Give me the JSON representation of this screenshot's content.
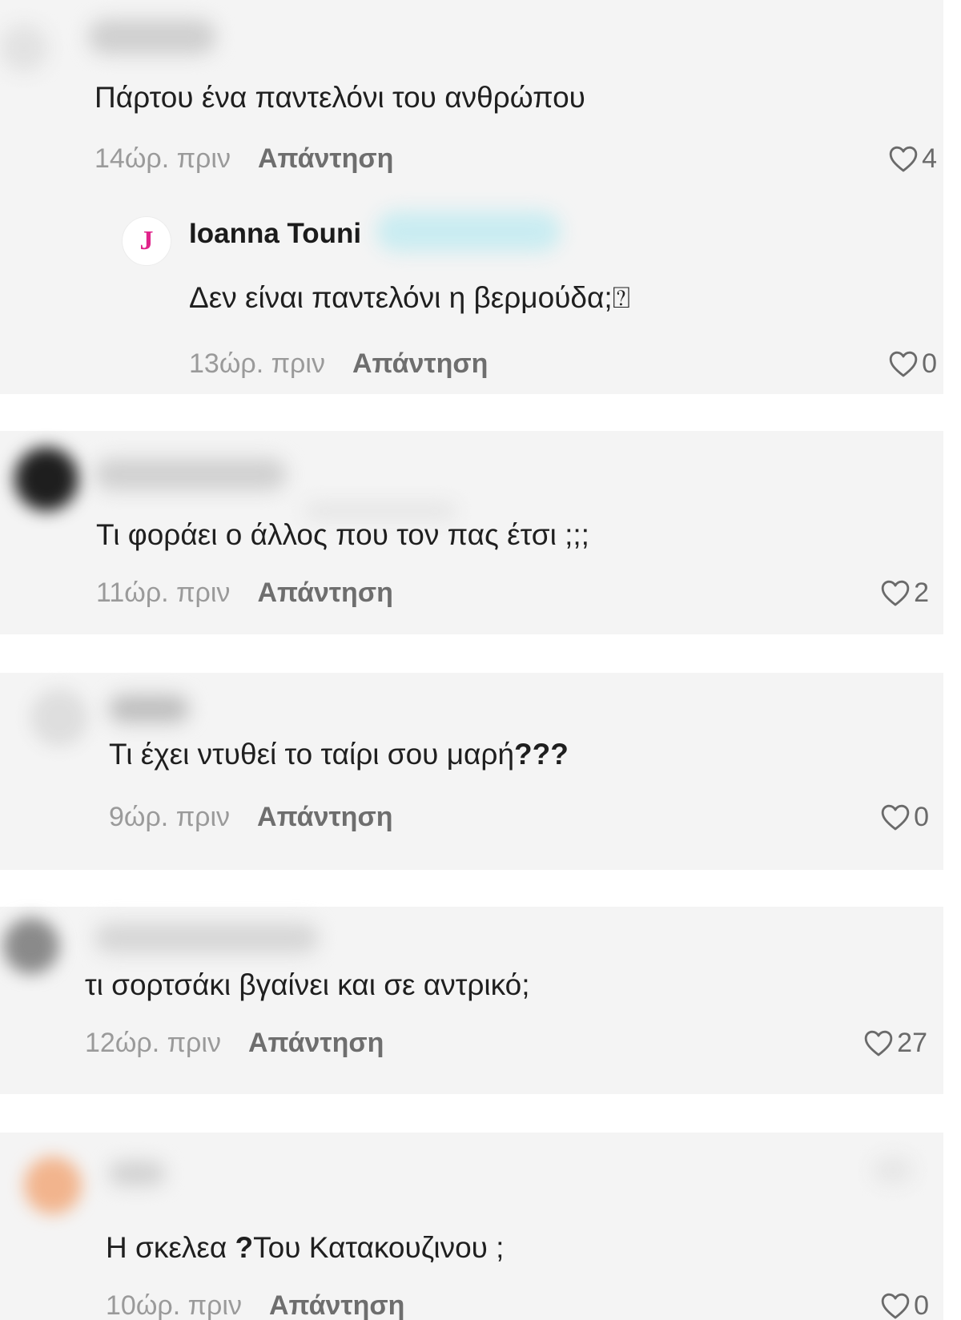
{
  "labels": {
    "reply": "Απάντηση"
  },
  "comments": [
    {
      "text": "Πάρτου ένα παντελόνι του ανθρώπου",
      "time": "14ώρ. πριν",
      "likes": "4",
      "reply": {
        "avatar_letter": "J",
        "username": "Ioanna Touni",
        "text": "Δεν είναι παντελόνι η βερμούδα;⍰",
        "time": "13ώρ. πριν",
        "likes": "0"
      }
    },
    {
      "text": "Τι φοράει ο άλλος που τον πας έτσι ;;;",
      "time": "11ώρ. πριν",
      "likes": "2"
    },
    {
      "text_plain": "Τι έχει ντυθεί το ταίρι σου μαρή",
      "text_bold": "???",
      "time": "9ώρ. πριν",
      "likes": "0"
    },
    {
      "text": "τι σορτσάκι βγαίνει και σε αντρικό;",
      "time": "12ώρ. πριν",
      "likes": "27"
    },
    {
      "text_a": "Η σκελεα ",
      "text_bold": "?",
      "text_b": "Του Κατακουζινου ;",
      "time": "10ώρ. πριν",
      "likes": "0"
    }
  ],
  "icons": {
    "like": "heart-outline-icon"
  },
  "colors": {
    "card_background": "#f4f4f4",
    "page_background": "#ffffff",
    "avatar_letter": "#e0238a",
    "time_text": "#9a9a9a",
    "reply_text": "#6e6e6e"
  }
}
